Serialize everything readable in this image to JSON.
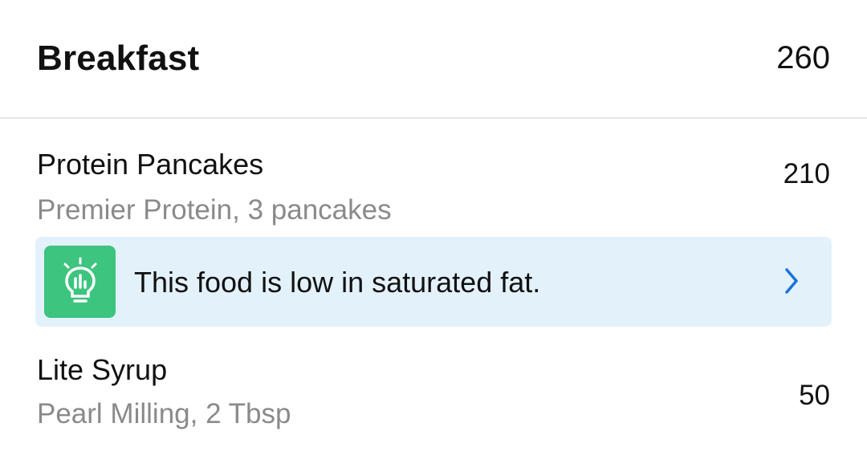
{
  "meal": {
    "title": "Breakfast",
    "total_calories": "260"
  },
  "foods": [
    {
      "name": "Protein Pancakes",
      "detail": "Premier Protein, 3 pancakes",
      "calories": "210"
    },
    {
      "name": "Lite Syrup",
      "detail": "Pearl Milling, 2 Tbsp",
      "calories": "50"
    }
  ],
  "tip": {
    "text": "This food is low in saturated fat.",
    "icon": "lightbulb-chart-icon",
    "chevron_icon": "chevron-right-icon",
    "badge_color": "#3dc47e",
    "background_color": "#e3f1fb",
    "chevron_color": "#1a73d9"
  }
}
